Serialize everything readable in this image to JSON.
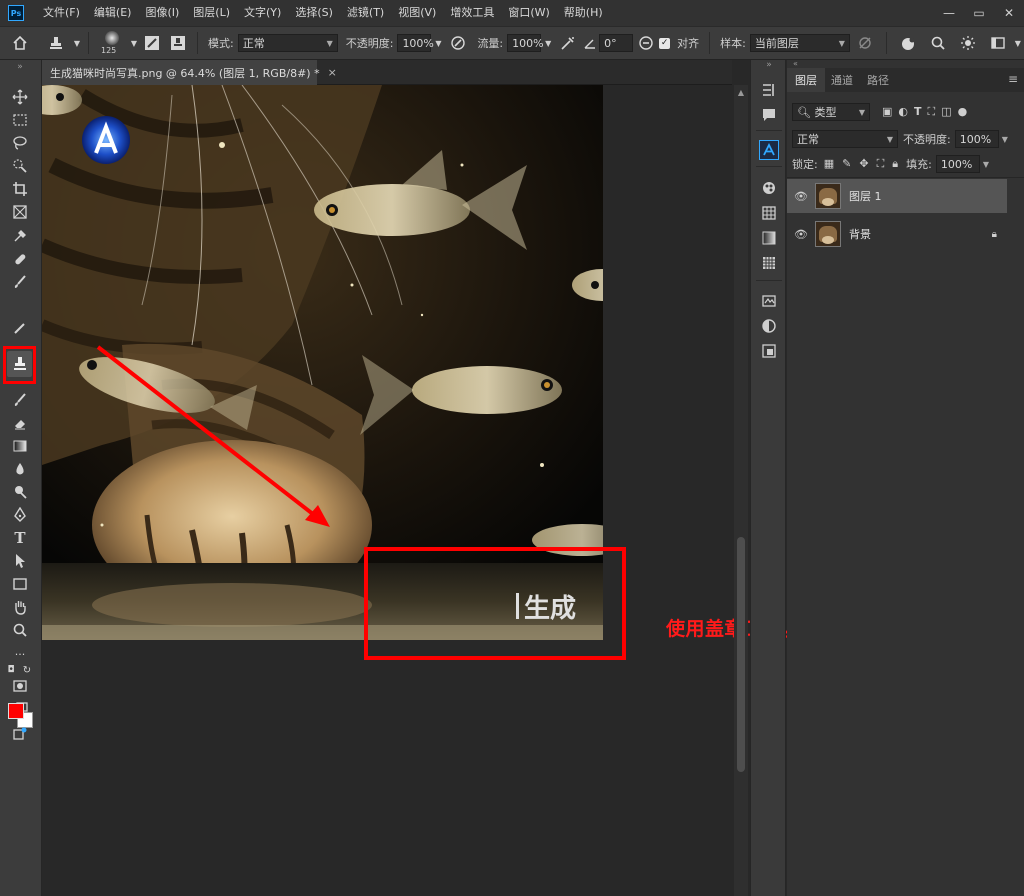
{
  "menubar": {
    "logo": "Ps",
    "items": [
      "文件(F)",
      "编辑(E)",
      "图像(I)",
      "图层(L)",
      "文字(Y)",
      "选择(S)",
      "滤镜(T)",
      "视图(V)",
      "增效工具",
      "窗口(W)",
      "帮助(H)"
    ],
    "window_controls": [
      "—",
      "▭",
      "✕"
    ]
  },
  "options": {
    "brush_size": "125",
    "mode_label": "模式:",
    "mode_value": "正常",
    "opacity_label": "不透明度:",
    "opacity_value": "100%",
    "flow_label": "流量:",
    "flow_value": "100%",
    "angle_value": "0°",
    "aligned_label": "对齐",
    "sample_label": "样本:",
    "sample_value": "当前图层"
  },
  "document": {
    "tab_title": "生成猫咪时尚写真.png @ 64.4% (图层 1, RGB/8#) *",
    "watermark_text": "生成"
  },
  "annotation": {
    "note": "使用盖章工具，遮盖掉水印",
    "color": "#ff0000"
  },
  "layers_panel": {
    "tabs": [
      "图层",
      "通道",
      "路径"
    ],
    "filter_label": "类型",
    "blend_mode": "正常",
    "opacity_label": "不透明度:",
    "opacity_value": "100%",
    "lock_label": "锁定:",
    "fill_label": "填充:",
    "fill_value": "100%",
    "layers": [
      {
        "name": "图层 1",
        "selected": true,
        "locked": false
      },
      {
        "name": "背景",
        "selected": false,
        "locked": true
      }
    ]
  },
  "colors": {
    "foreground": "#ff0000",
    "background": "#ffffff",
    "accent": "#31a8ff"
  }
}
